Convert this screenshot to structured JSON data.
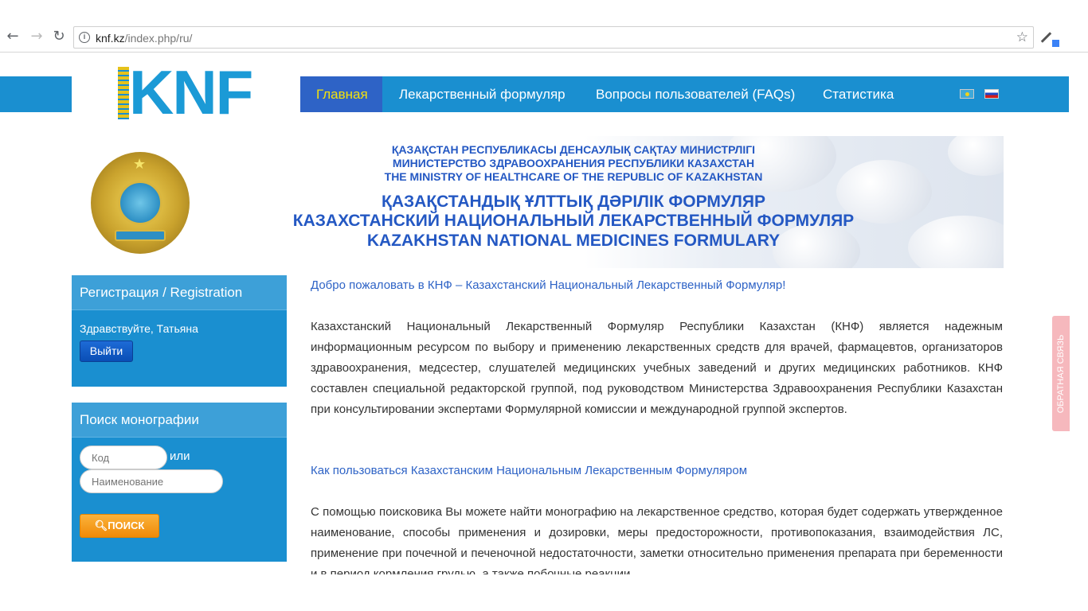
{
  "browser": {
    "url_host": "knf.kz",
    "url_path": "/index.php/ru/"
  },
  "logo": {
    "text": "KNF"
  },
  "nav": {
    "items": [
      "Главная",
      "Лекарственный формуляр",
      "Вопросы пользователей (FAQs)",
      "Статистика"
    ],
    "active_index": 0,
    "languages": [
      "kz-flag",
      "ru-flag"
    ]
  },
  "banner": {
    "ministry_kz": "ҚАЗАҚСТАН РЕСПУБЛИКАСЫ ДЕНСАУЛЫҚ САҚТАУ МИНИСТРЛІГІ",
    "ministry_ru": "МИНИСТЕРСТВО ЗДРАВООХРАНЕНИЯ РЕСПУБЛИКИ КАЗАХСТАН",
    "ministry_en": "THE MINISTRY OF HEALTHCARE OF THE REPUBLIC OF KAZAKHSTAN",
    "formulary_kz": "ҚАЗАҚСТАНДЫҚ ҰЛТТЫҚ ДӘРІЛІК ФОРМУЛЯР",
    "formulary_ru": "КАЗАХСТАНСКИЙ НАЦИОНАЛЬНЫЙ ЛЕКАРСТВЕННЫЙ ФОРМУЛЯР",
    "formulary_en": "KAZAKHSTAN NATIONAL MEDICINES FORMULARY"
  },
  "registration": {
    "title": "Регистрация / Registration",
    "greeting": "Здравствуйте, Татьяна",
    "logout_label": "Выйти"
  },
  "search": {
    "title": "Поиск монографии",
    "code_placeholder": "Код",
    "or_label": "или",
    "name_placeholder": "Наименование",
    "button_label": "ПОИСК"
  },
  "main": {
    "welcome": "Добро пожаловать в КНФ – Казахстанский Национальный Лекарственный Формуляр!",
    "intro": "Казахстанский Национальный Лекарственный Формуляр Республики Казахстан (КНФ) является надежным информационным ресурсом по выбору и применению лекарственных средств для врачей, фармацевтов, организаторов здравоохранения, медсестер, слушателей медицинских учебных заведений и других медицинских работников. КНФ составлен специальной редакторской группой, под руководством Министерства Здравоохранения Республики Казахстан при консультировании экспертами Формулярной комиссии и международной группой экспертов.",
    "howto_title": "Как пользоваться Казахстанским Национальным Лекарственным Формуляром",
    "howto_text": "С помощью поисковика Вы можете найти монографию на лекарственное средство, которая будет содержать утвержденное наименование, способы применения и дозировки, меры предосторожности, противопоказания, взаимодействия ЛС, применение при почечной и печеночной недостаточности, заметки относительно применения препарата при беременности и в период кормления грудью, а также побочные реакции."
  },
  "feedback": {
    "label": "ОБРАТНАЯ СВЯЗЬ"
  }
}
